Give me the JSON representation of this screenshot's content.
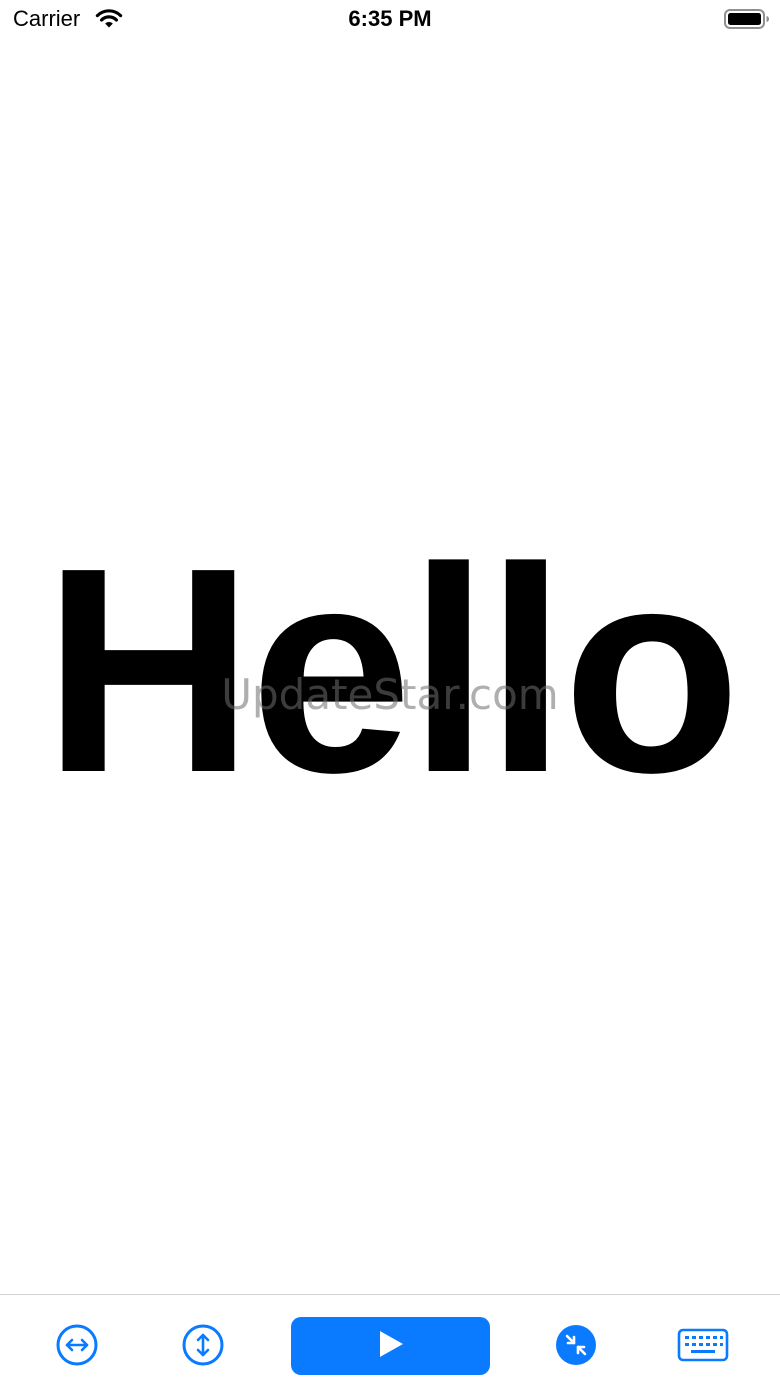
{
  "status_bar": {
    "carrier": "Carrier",
    "time": "6:35 PM",
    "wifi_icon": "wifi-icon",
    "battery_icon": "battery-icon"
  },
  "content": {
    "display_text": "Hello",
    "watermark": "UpdateStar.com"
  },
  "toolbar": {
    "buttons": [
      {
        "icon": "horizontal-arrows-circle-icon"
      },
      {
        "icon": "vertical-arrows-circle-icon"
      },
      {
        "icon": "play-icon"
      },
      {
        "icon": "compress-arrows-circle-icon"
      },
      {
        "icon": "keyboard-icon"
      }
    ]
  },
  "colors": {
    "accent": "#0a7aff",
    "text": "#000000",
    "background": "#ffffff"
  }
}
